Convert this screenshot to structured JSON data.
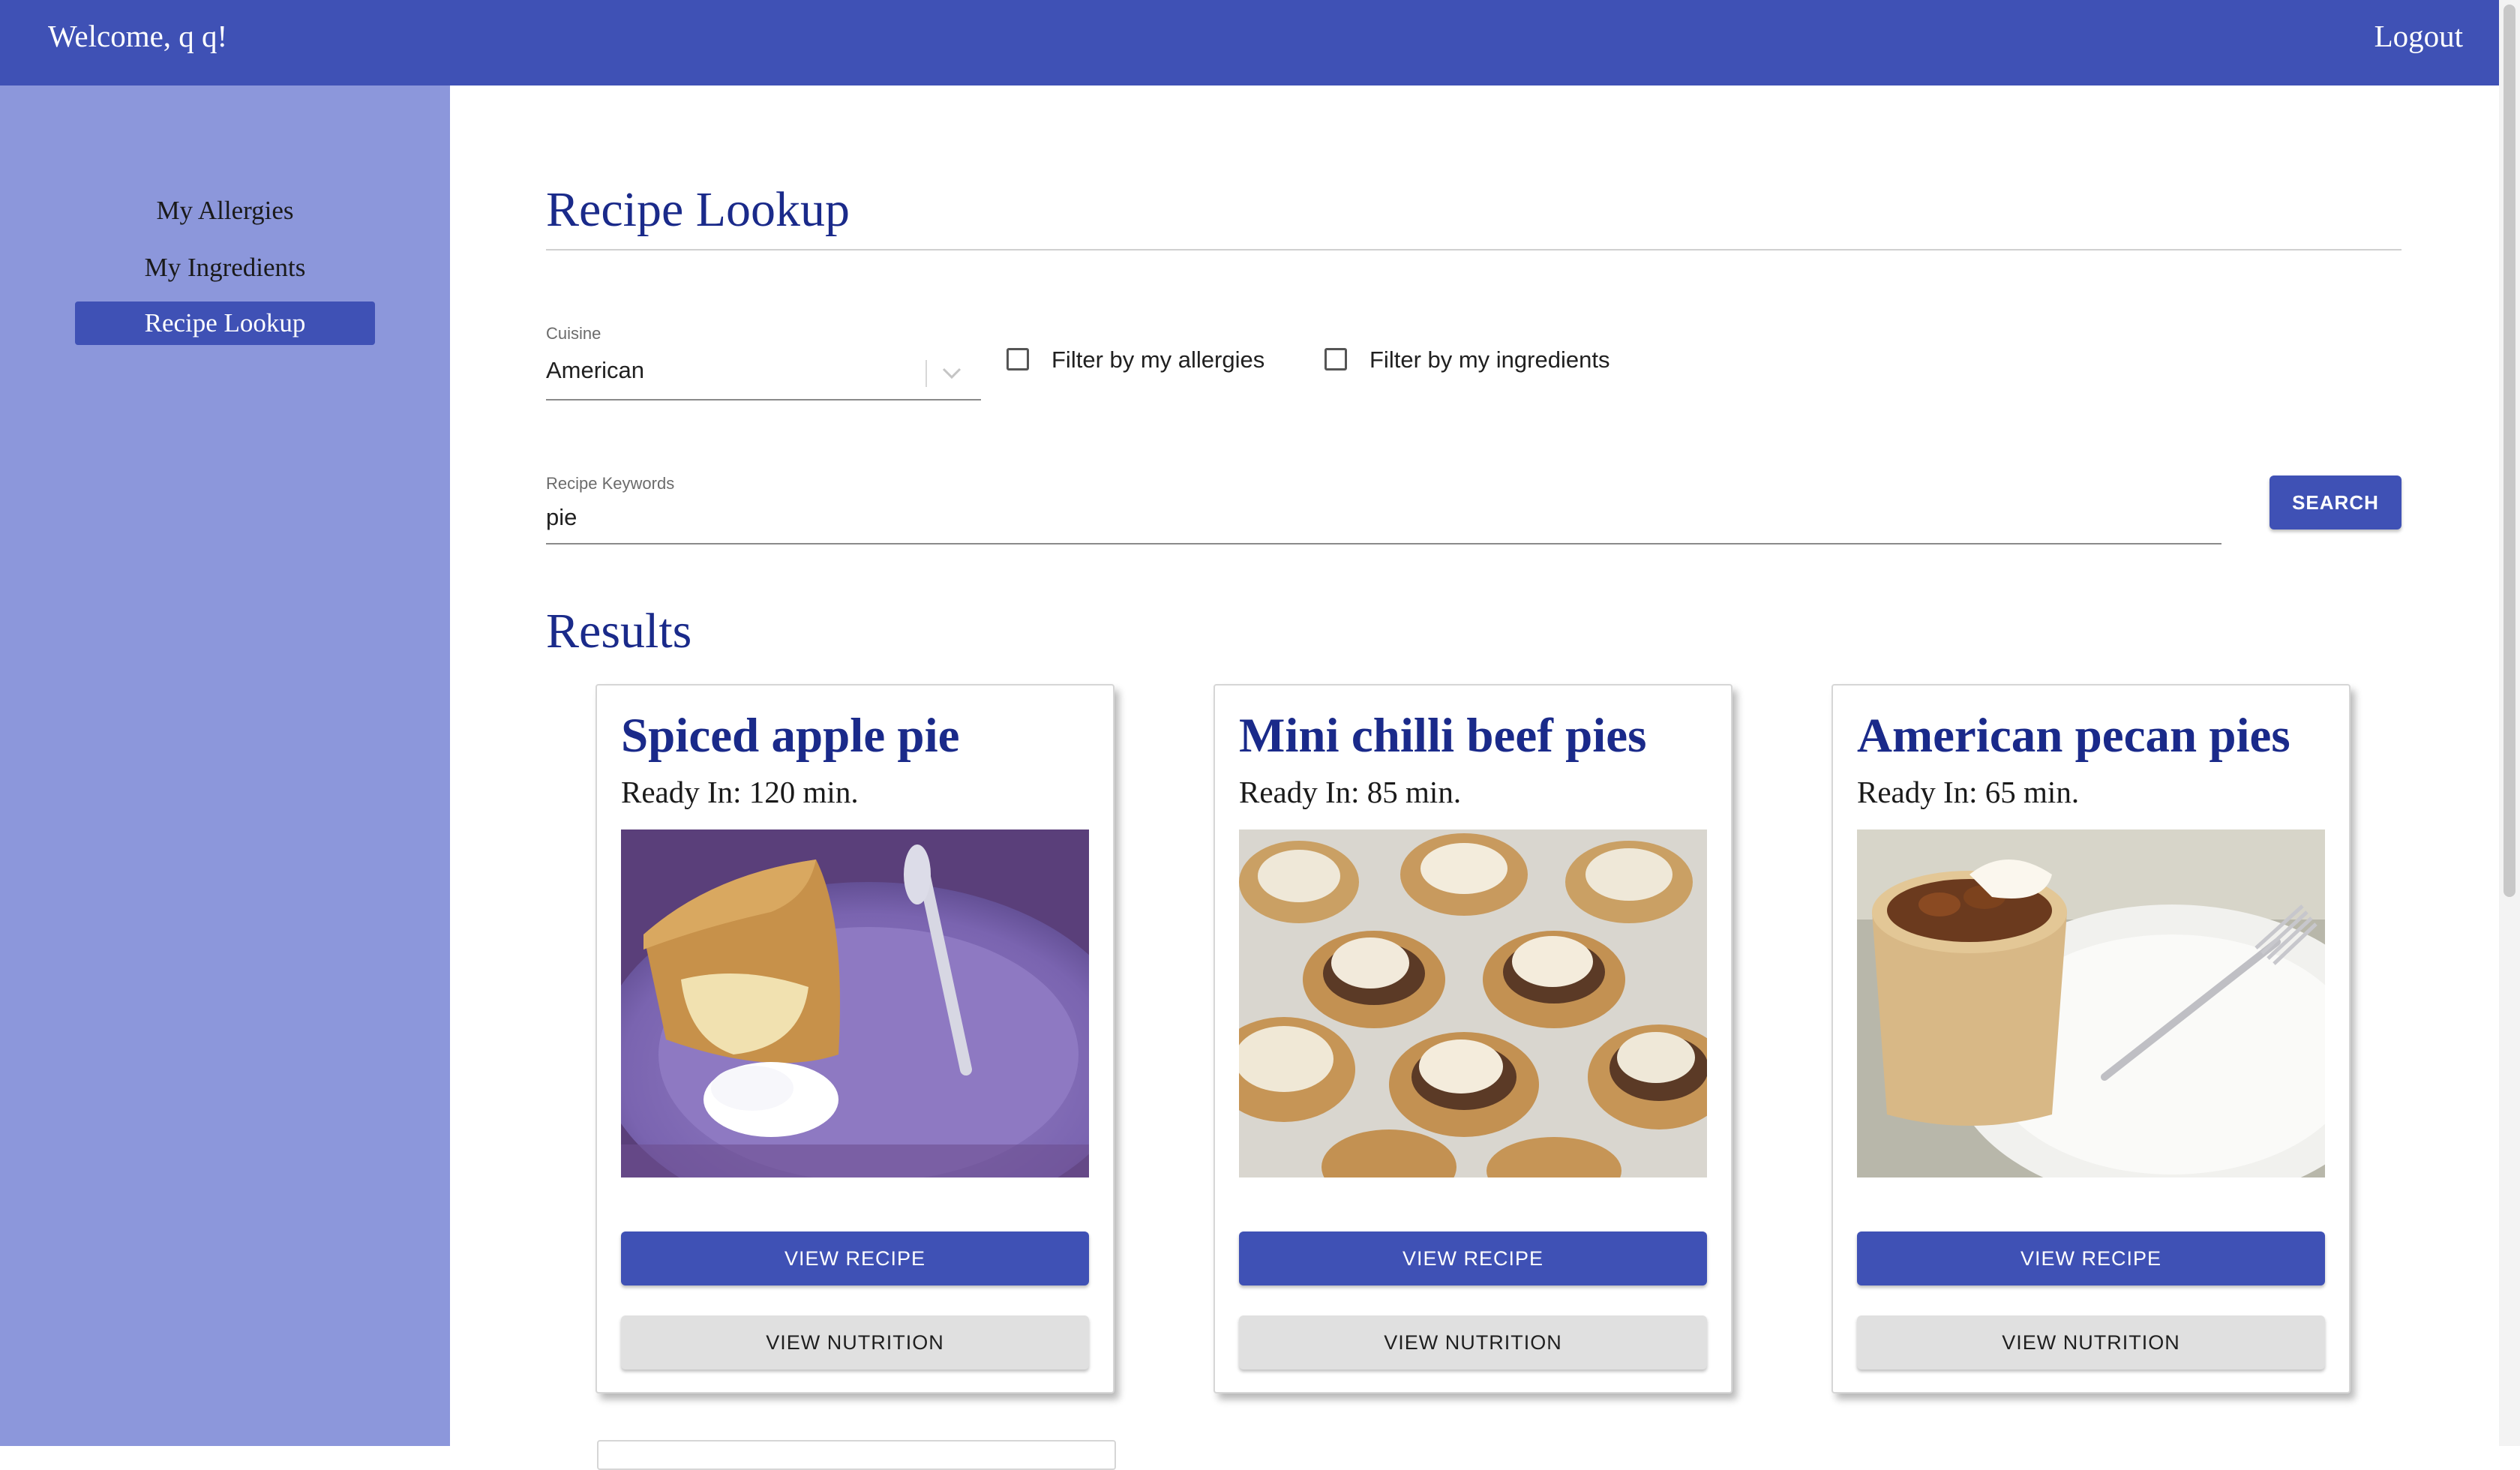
{
  "header": {
    "welcome": "Welcome, q q!",
    "logout": "Logout"
  },
  "sidebar": {
    "items": [
      {
        "label": "My Allergies",
        "active": false
      },
      {
        "label": "My Ingredients",
        "active": false
      },
      {
        "label": "Recipe Lookup",
        "active": true
      }
    ]
  },
  "page": {
    "title": "Recipe Lookup",
    "results_title": "Results"
  },
  "filters": {
    "cuisine_label": "Cuisine",
    "cuisine_value": "American",
    "allergies_label": "Filter by my allergies",
    "allergies_checked": false,
    "ingredients_label": "Filter by my ingredients",
    "ingredients_checked": false,
    "keywords_label": "Recipe Keywords",
    "keywords_value": "pie",
    "search_label": "SEARCH"
  },
  "results": [
    {
      "title": "Spiced apple pie",
      "ready": "Ready In: 120 min.",
      "image": "apple-pie-photo",
      "view_recipe": "VIEW RECIPE",
      "view_nutrition": "VIEW NUTRITION"
    },
    {
      "title": "Mini chilli beef pies",
      "ready": "Ready In: 85 min.",
      "image": "mini-beef-pies-photo",
      "view_recipe": "VIEW RECIPE",
      "view_nutrition": "VIEW NUTRITION"
    },
    {
      "title": "American pecan pies",
      "ready": "Ready In: 65 min.",
      "image": "pecan-pie-photo",
      "view_recipe": "VIEW RECIPE",
      "view_nutrition": "VIEW NUTRITION"
    }
  ],
  "colors": {
    "primary": "#3f51b5",
    "sidebar": "#8c97db",
    "heading": "#1a2a8a",
    "secondary_button": "#e0e0e0"
  }
}
